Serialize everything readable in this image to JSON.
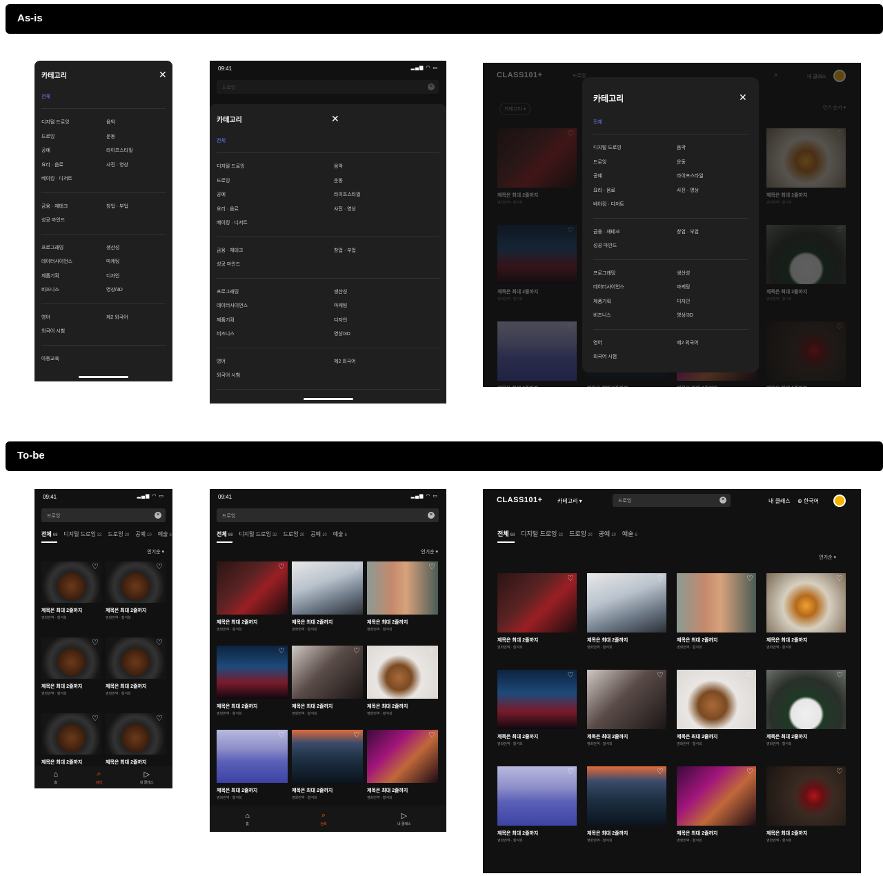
{
  "labels": {
    "asis": "As-is",
    "tobe": "To-be"
  },
  "sheet": {
    "title": "카테고리",
    "all": "전체",
    "groups": [
      [
        "디지털 드로잉",
        "음악",
        "드로잉",
        "운동",
        "공예",
        "라이프스타일",
        "요리 · 음료",
        "사진 · 영상",
        "베이킹 · 디저트"
      ],
      [
        "금융 · 재테크",
        "창업 · 부업",
        "성공 마인드"
      ],
      [
        "프로그래밍",
        "생산성",
        "데이터사이언스",
        "마케팅",
        "제품기획",
        "디자인",
        "비즈니스",
        "영상/3D"
      ],
      [
        "영어",
        "제2 외국어",
        "외국어 시험"
      ],
      [
        "아동교육"
      ]
    ]
  },
  "status": {
    "time": "09:41"
  },
  "search": {
    "query": "드로잉"
  },
  "tabs": [
    {
      "label": "전체",
      "count": "68"
    },
    {
      "label": "디지털 드로잉",
      "count": "32"
    },
    {
      "label": "드로잉",
      "count": "20"
    },
    {
      "label": "공예",
      "count": "10"
    },
    {
      "label": "예술",
      "count": "6"
    }
  ],
  "sort": "인기순",
  "card": {
    "title": "제목은 최대 2줄까지",
    "meta": "영화번역 · 황석희"
  },
  "nav": [
    {
      "label": "홈",
      "icon": "home-icon"
    },
    {
      "label": "검색",
      "icon": "search-icon"
    },
    {
      "label": "내 클래스",
      "icon": "play-icon"
    }
  ],
  "header": {
    "logo": "CLASS101+",
    "category": "카테고리",
    "my_class": "내 클래스",
    "language": "한국어"
  },
  "asis_desktop": {
    "category_btn": "카테고리",
    "sort": "인기 순서"
  },
  "colors": {
    "accent": "#ff5600",
    "link": "#6c7cff",
    "bg": "#111111"
  },
  "thumbs": [
    "img-phone",
    "img-laptop",
    "img-building",
    "img-whisky",
    "img-street",
    "img-dress",
    "img-dog",
    "img-plant",
    "img-snow",
    "img-sea",
    "img-face",
    "img-candle"
  ]
}
